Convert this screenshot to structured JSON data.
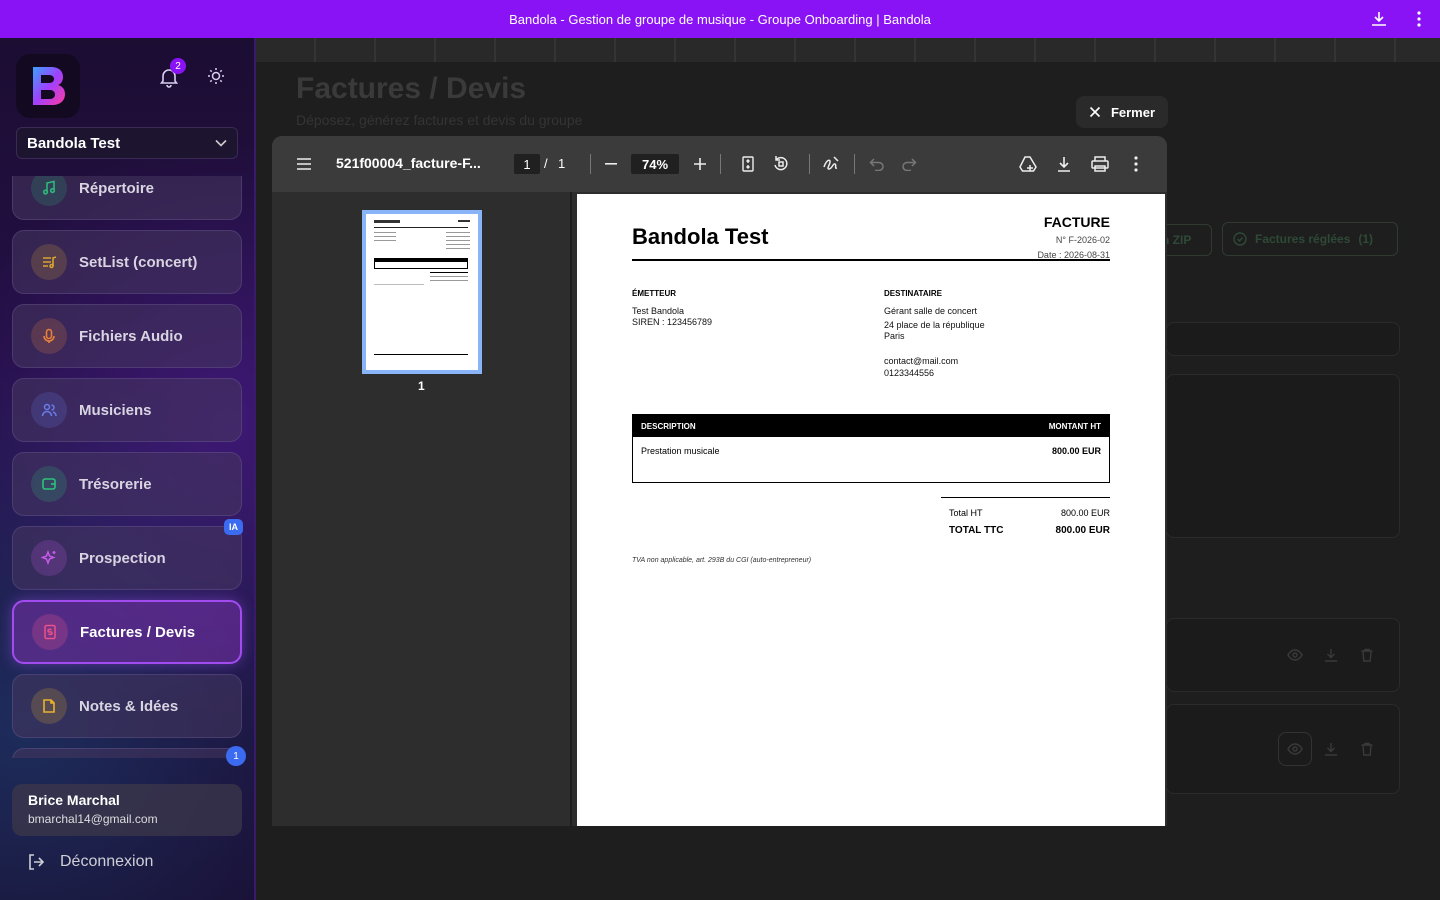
{
  "window": {
    "title": "Bandola - Gestion de groupe de musique - Groupe Onboarding | Bandola"
  },
  "sidebar": {
    "notification_count": "2",
    "group_name": "Bandola Test",
    "items": [
      {
        "label": "Répertoire",
        "icon": "music-note-icon",
        "color": "#2fb67a"
      },
      {
        "label": "SetList (concert)",
        "icon": "playlist-icon",
        "color": "#d6a431"
      },
      {
        "label": "Fichiers Audio",
        "icon": "microphone-icon",
        "color": "#e8803a"
      },
      {
        "label": "Musiciens",
        "icon": "users-icon",
        "color": "#6a7ce8"
      },
      {
        "label": "Trésorerie",
        "icon": "wallet-icon",
        "color": "#2fc07a"
      },
      {
        "label": "Prospection",
        "icon": "sparkles-icon",
        "color": "#c45ae8",
        "badge": "IA"
      },
      {
        "label": "Factures / Devis",
        "icon": "invoice-icon",
        "color": "#e8528a",
        "active": true
      },
      {
        "label": "Notes & Idées",
        "icon": "note-icon",
        "color": "#e8b22f"
      }
    ],
    "hidden_item_badge": "1",
    "user": {
      "name": "Brice Marchal",
      "email": "bmarchal14@gmail.com"
    },
    "logout_label": "Déconnexion"
  },
  "main": {
    "title": "Factures / Devis",
    "subtitle": "Déposez, générez factures et devis du groupe",
    "zip_button_partial": "n ZIP",
    "paid_button": "Factures réglées",
    "paid_count": "(1)",
    "close_label": "Fermer"
  },
  "viewer": {
    "filename": "521f00004_facture-F...",
    "current_page": "1",
    "page_sep": "/",
    "total_pages": "1",
    "zoom": "74%",
    "thumb_label": "1"
  },
  "invoice": {
    "company": "Bandola Test",
    "doc_type": "FACTURE",
    "number": "N° F-2026-02",
    "date": "Date : 2026-08-31",
    "emitter_label": "ÉMETTEUR",
    "emitter_name": "Test Bandola",
    "emitter_siren": "SIREN : 123456789",
    "recipient_label": "DESTINATAIRE",
    "recipient_name": "Gérant salle de concert",
    "recipient_address": "24 place de la république",
    "recipient_city": "Paris",
    "recipient_email": "contact@mail.com",
    "recipient_phone": "0123344556",
    "table_desc_header": "DESCRIPTION",
    "table_amount_header": "MONTANT HT",
    "line_desc": "Prestation musicale",
    "line_amount": "800.00 EUR",
    "total_ht_label": "Total HT",
    "total_ht": "800.00 EUR",
    "total_ttc_label": "TOTAL TTC",
    "total_ttc": "800.00 EUR",
    "vat_note": "TVA non applicable, art. 293B du CGI (auto-entrepreneur)"
  }
}
